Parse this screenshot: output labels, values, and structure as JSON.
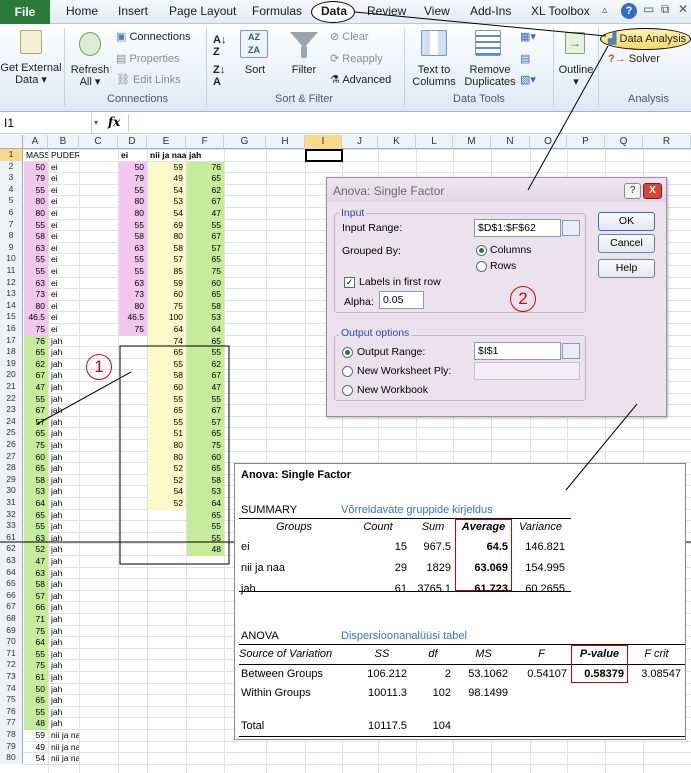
{
  "tabs": {
    "file": "File",
    "home": "Home",
    "insert": "Insert",
    "page_layout": "Page Layout",
    "formulas": "Formulas",
    "data": "Data",
    "review": "Review",
    "view": "View",
    "addins": "Add-Ins",
    "xltoolbox": "XL Toolbox"
  },
  "ribbon": {
    "get_external": [
      "Get External",
      "Data"
    ],
    "refresh": [
      "Refresh",
      "All"
    ],
    "connections": "Connections",
    "properties": "Properties",
    "edit_links": "Edit Links",
    "connections_group": "Connections",
    "sort": "Sort",
    "filter": "Filter",
    "clear": "Clear",
    "reapply": "Reapply",
    "advanced": "Advanced",
    "sort_filter_group": "Sort & Filter",
    "text_to_columns": [
      "Text to",
      "Columns"
    ],
    "remove_duplicates": [
      "Remove",
      "Duplicates"
    ],
    "data_tools_group": "Data Tools",
    "outline": "Outline",
    "data_analysis": "Data Analysis",
    "solver": "Solver",
    "analysis_group": "Analysis"
  },
  "formula_bar": {
    "name_box": "I1",
    "fx": "fx"
  },
  "columns": [
    "A",
    "B",
    "C",
    "D",
    "E",
    "F",
    "G",
    "H",
    "I",
    "J",
    "K",
    "L",
    "M",
    "N",
    "O",
    "P",
    "Q",
    "R"
  ],
  "sheet": {
    "headers": {
      "a": "MASS",
      "b": "PUDER",
      "d": "ei",
      "e": "nii ja naa",
      "f": "jah"
    },
    "rows": [
      2,
      3,
      4,
      5,
      6,
      7,
      8,
      9,
      10,
      11,
      12,
      13,
      14,
      15,
      16,
      17,
      18,
      19,
      20,
      21,
      22,
      23,
      24,
      25,
      26,
      27,
      28,
      29,
      30,
      31,
      32,
      33,
      61,
      62,
      63,
      64,
      65,
      66,
      67,
      68,
      69,
      70,
      71,
      72,
      73,
      74,
      75,
      76,
      77,
      78,
      79,
      80
    ],
    "col_a": [
      "50",
      "79",
      "55",
      "80",
      "80",
      "55",
      "58",
      "63",
      "55",
      "55",
      "63",
      "73",
      "80",
      "46.5",
      "75",
      "76",
      "65",
      "62",
      "67",
      "47",
      "55",
      "67",
      "57",
      "65",
      "75",
      "60",
      "65",
      "58",
      "53",
      "64",
      "65",
      "55",
      "63",
      "52",
      "47",
      "63",
      "58",
      "57",
      "66",
      "71",
      "75",
      "64",
      "55",
      "75",
      "61",
      "50",
      "65",
      "55",
      "48",
      "59",
      "49",
      "54"
    ],
    "col_b": [
      "ei",
      "ei",
      "ei",
      "ei",
      "ei",
      "ei",
      "ei",
      "ei",
      "ei",
      "ei",
      "ei",
      "ei",
      "ei",
      "ei",
      "ei",
      "jah",
      "jah",
      "jah",
      "jah",
      "jah",
      "jah",
      "jah",
      "jah",
      "jah",
      "jah",
      "jah",
      "jah",
      "jah",
      "jah",
      "jah",
      "jah",
      "jah",
      "jah",
      "jah",
      "jah",
      "jah",
      "jah",
      "jah",
      "jah",
      "jah",
      "jah",
      "jah",
      "jah",
      "jah",
      "jah",
      "jah",
      "jah",
      "jah",
      "jah",
      "nii ja naa",
      "nii ja naa",
      "nii ja naa"
    ],
    "col_d": [
      "50",
      "79",
      "55",
      "80",
      "80",
      "55",
      "58",
      "63",
      "55",
      "55",
      "63",
      "73",
      "80",
      "46.5",
      "75"
    ],
    "col_e": [
      "59",
      "49",
      "54",
      "53",
      "54",
      "69",
      "80",
      "58",
      "57",
      "85",
      "59",
      "60",
      "75",
      "100",
      "64",
      "74",
      "65",
      "55",
      "58",
      "60",
      "55",
      "65",
      "55",
      "51",
      "80",
      "80",
      "52",
      "52",
      "54",
      "52"
    ],
    "col_f": [
      "76",
      "65",
      "62",
      "67",
      "47",
      "55",
      "67",
      "57",
      "65",
      "75",
      "60",
      "65",
      "58",
      "53",
      "64",
      "65",
      "55",
      "62",
      "67",
      "47",
      "55",
      "67",
      "57",
      "65",
      "75",
      "60",
      "65",
      "58",
      "53",
      "64",
      "65",
      "55",
      "55",
      "48"
    ]
  },
  "dialog": {
    "title": "Anova: Single Factor",
    "input": "Input",
    "input_range_label": "Input Range:",
    "input_range": "$D$1:$F$62",
    "grouped_by": "Grouped By:",
    "columns": "Columns",
    "rows": "Rows",
    "labels": "Labels in first row",
    "alpha_label": "Alpha:",
    "alpha": "0.05",
    "output_options": "Output options",
    "output_range": "Output Range:",
    "output_range_value": "$I$1",
    "new_ply": "New Worksheet Ply:",
    "new_workbook": "New Workbook",
    "ok": "OK",
    "cancel": "Cancel",
    "help": "Help",
    "close": "X",
    "question": "?"
  },
  "markers": {
    "one": "1",
    "two": "2"
  },
  "output": {
    "title": "Anova: Single Factor",
    "summary": "SUMMARY",
    "summary_desc": "Võrreldavate gruppide kirjeldus",
    "sum_headers": [
      "Groups",
      "Count",
      "Sum",
      "Average",
      "Variance"
    ],
    "sum_rows": [
      [
        "ei",
        "15",
        "967.5",
        "64.5",
        "146.821"
      ],
      [
        "nii ja naa",
        "29",
        "1829",
        "63.069",
        "154.995"
      ],
      [
        "jah",
        "61",
        "3765.1",
        "61.723",
        "60.2655"
      ]
    ],
    "anova": "ANOVA",
    "anova_desc": "Dispersioonanalüüsi tabel",
    "an_headers": [
      "Source of Variation",
      "SS",
      "df",
      "MS",
      "F",
      "P-value",
      "F crit"
    ],
    "an_rows": [
      [
        "Between Groups",
        "106.212",
        "2",
        "53.1062",
        "0.54107",
        "0.58379",
        "3.08547"
      ],
      [
        "Within Groups",
        "10011.3",
        "102",
        "98.1499",
        "",
        "",
        ""
      ]
    ],
    "total": [
      "Total",
      "10117.5",
      "104"
    ]
  }
}
